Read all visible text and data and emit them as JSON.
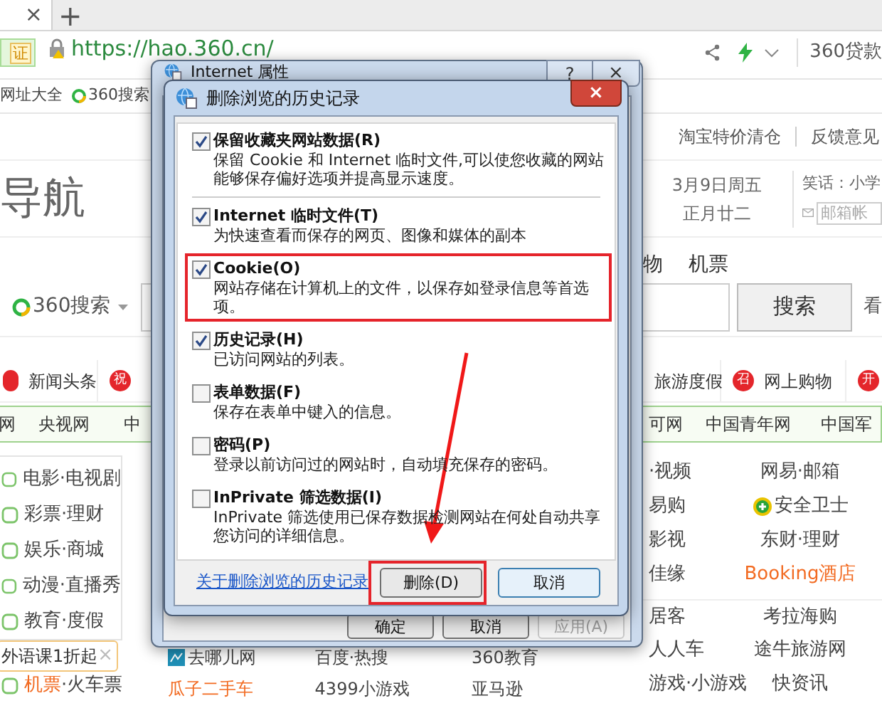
{
  "browser": {
    "tab_close": "×",
    "new_tab": "+",
    "security_badge": "证",
    "url": "https://hao.360.cn/",
    "toolbar_text": "360贷款"
  },
  "bookmarks": [
    "网址大全",
    "360搜索"
  ],
  "top_links": [
    "淘宝特价清仓",
    "反馈意见"
  ],
  "header": {
    "logo": "导航",
    "date": "3月9日周五",
    "lunar_date": "正月廿二",
    "joke": "笑话：小学",
    "mail_placeholder": "邮箱帐"
  },
  "search": {
    "tabs": [
      "物",
      "机票"
    ],
    "engine": "360搜索",
    "button": "搜索",
    "side_text": "看"
  },
  "quick_links": [
    {
      "icon": true,
      "label": "新闻头条"
    },
    {
      "badge": "祝"
    },
    {
      "label": "旅游度假"
    },
    {
      "badge": "召",
      "label": "网上购物"
    },
    {
      "badge": "开"
    }
  ],
  "site_links": [
    "网",
    "央视网",
    "中",
    "可网",
    "中国青年网",
    "中国军"
  ],
  "categories": [
    {
      "label": "电影·电视剧"
    },
    {
      "label": "彩票·理财"
    },
    {
      "label": "娱乐·商城"
    },
    {
      "label": "动漫·直播秀"
    },
    {
      "label": "教育·度假"
    }
  ],
  "promo": {
    "text": "外语课1折起",
    "close": "×"
  },
  "category_last": {
    "highlight": "机票",
    "rest": "·火车票"
  },
  "bottom_links": [
    [
      {
        "text": "去哪儿网",
        "highlighted": false
      },
      {
        "text": "百度·热搜",
        "highlighted": false
      },
      {
        "text": "360教育",
        "highlighted": false
      }
    ],
    [
      {
        "text": "瓜子二手车",
        "highlighted": true
      },
      {
        "text": "4399小游戏",
        "highlighted": false
      },
      {
        "text": "亚马逊",
        "highlighted": false
      }
    ]
  ],
  "right_links": [
    [
      {
        "text": "·视频",
        "highlighted": false
      },
      {
        "text": "网易·邮箱",
        "highlighted": false
      }
    ],
    [
      {
        "text": "易购",
        "highlighted": false
      },
      {
        "text": "安全卫士",
        "highlighted": false
      }
    ],
    [
      {
        "text": "影视",
        "highlighted": false
      },
      {
        "text": "东财·理财",
        "highlighted": false
      }
    ],
    [
      {
        "text": "佳缘",
        "highlighted": false
      },
      {
        "text": "Booking酒店",
        "highlighted": true
      }
    ],
    [
      {
        "text": "居客",
        "highlighted": false
      },
      {
        "text": "考拉海购",
        "highlighted": false
      }
    ],
    [
      {
        "text": "人人车",
        "highlighted": false
      },
      {
        "text": "途牛旅游网",
        "highlighted": false
      }
    ],
    [
      {
        "text": "游戏·小游戏",
        "highlighted": false
      },
      {
        "text": "快资讯",
        "highlighted": false
      }
    ]
  ],
  "properties_dialog": {
    "title": "Internet 属性",
    "help": "?",
    "close": "×",
    "buttons": [
      {
        "label": "确定",
        "disabled": false
      },
      {
        "label": "取消",
        "disabled": false
      },
      {
        "label": "应用(A)",
        "disabled": true
      }
    ]
  },
  "delete_history_dialog": {
    "title": "删除浏览的历史记录",
    "close": "×",
    "show_arrow": true,
    "options": [
      {
        "label": "保留收藏夹网站数据(R)",
        "description": "保留 Cookie 和 Internet 临时文件,可以使您收藏的网站能够保存偏好选项并提高显示速度。",
        "checked": true,
        "highlighted": false
      },
      {
        "label": "Internet 临时文件(T)",
        "description": "为快速查看而保存的网页、图像和媒体的副本",
        "checked": true,
        "highlighted": false
      },
      {
        "label": "Cookie(O)",
        "description": "网站存储在计算机上的文件，以保存如登录信息等首选项。",
        "checked": true,
        "highlighted": true
      },
      {
        "label": "历史记录(H)",
        "description": "已访问网站的列表。",
        "checked": true,
        "highlighted": false
      },
      {
        "label": "表单数据(F)",
        "description": "保存在表单中键入的信息。",
        "checked": false,
        "highlighted": false
      },
      {
        "label": "密码(P)",
        "description": "登录以前访问过的网站时，自动填充保存的密码。",
        "checked": false,
        "highlighted": false
      },
      {
        "label": "InPrivate 筛选数据(I)",
        "description": "InPrivate 筛选使用已保存数据检测网站在何处自动共享您访问的详细信息。",
        "checked": false,
        "highlighted": false
      }
    ],
    "link": "关于删除浏览的历史记录",
    "buttons": [
      {
        "label": "删除(D)",
        "highlighted": true
      },
      {
        "label": "取消",
        "highlighted": false
      }
    ]
  }
}
